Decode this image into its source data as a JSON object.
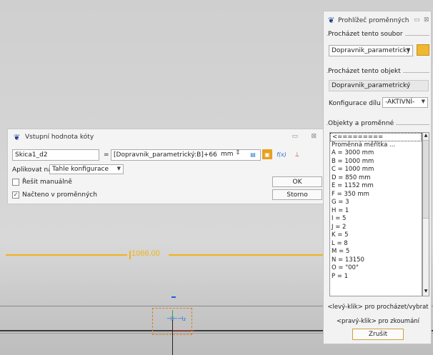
{
  "viewport": {
    "dimension_value": "1066.00",
    "sketch_glyph": "⊣⊢⊣₂"
  },
  "dimension_dialog": {
    "title": "Vstupní hodnota kóty",
    "name_value": "Skica1_d2",
    "equals": "=",
    "expression_value": "[Dopravnik_parametrický:B]+66",
    "unit": "mm",
    "apply_label": "Aplikovat na",
    "apply_value": "Tahle konfigurace",
    "solve_manual_label": "Řešit manuálně",
    "solve_manual_checked": false,
    "loaded_in_vars_label": "Načteno v proměnných",
    "loaded_in_vars_checked": true,
    "ok_label": "OK",
    "cancel_label": "Storno",
    "fx_label": "f(x)"
  },
  "variable_browser": {
    "title": "Prohlížeč proměnných",
    "file_group_label": "Procházet tento soubor",
    "file_value": "Dopravnik_parametricky",
    "object_group_label": "Procházet tento objekt",
    "object_value": "Dopravnik_parametrický",
    "config_label": "Konfigurace dílu",
    "config_value": "-AKTIVNÍ-",
    "vars_group_label": "Objekty a proměnné",
    "items": [
      "<=========",
      "Proměnná měřítka ...",
      "A = 3000 mm",
      "B = 1000 mm",
      "C = 1000 mm",
      "D = 850 mm",
      "E = 1152 mm",
      "F = 350 mm",
      "G = 3",
      "H = 1",
      "I = 5",
      "J = 2",
      "K = 5",
      "L = 8",
      "M = 5",
      "N = 13150",
      "O = \"00\"",
      "P = 1"
    ],
    "hint_left": "<levý-klik> pro procházet/vybrat",
    "hint_right": "<pravý-klik> pro zkoumání",
    "cancel_label": "Zrušit"
  },
  "colors": {
    "dimension": "#f2b318",
    "selection": "#d2822a",
    "accent_blue": "#1b3f8b"
  }
}
